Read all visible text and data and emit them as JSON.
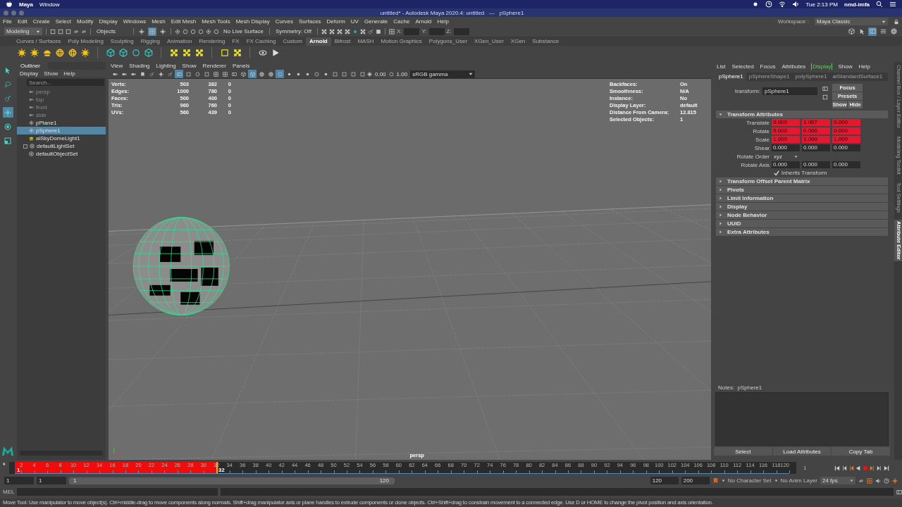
{
  "menubar": {
    "app": "Maya",
    "menus": [
      "Window"
    ],
    "clock": "Tue 2:13 PM",
    "user": "nmd-imfa"
  },
  "window": {
    "title": "untitled* - Autodesk Maya 2020.4: untitled   ---   pSphere1"
  },
  "main_menu": [
    "File",
    "Edit",
    "Create",
    "Select",
    "Modify",
    "Display",
    "Windows",
    "Mesh",
    "Edit Mesh",
    "Mesh Tools",
    "Mesh Display",
    "Curves",
    "Surfaces",
    "Deform",
    "UV",
    "Generate",
    "Cache",
    "Arnold",
    "Help"
  ],
  "workspace": {
    "label": "Workspace :",
    "value": "Maya Classic"
  },
  "status_line": {
    "menu_set": "Modeling",
    "selection_mode": "Objects",
    "live_surface": "No Live Surface",
    "symmetry": "Symmetry: Off",
    "coords": [
      "X:",
      "Y:",
      "Z:"
    ]
  },
  "shelf_tabs": [
    {
      "label": "Curves / Surfaces",
      "selected": false
    },
    {
      "label": "Poly Modeling",
      "selected": false
    },
    {
      "label": "Sculpting",
      "selected": false
    },
    {
      "label": "Rigging",
      "selected": false
    },
    {
      "label": "Animation",
      "selected": false
    },
    {
      "label": "Rendering",
      "selected": false
    },
    {
      "label": "FX",
      "selected": false
    },
    {
      "label": "FX Caching",
      "selected": false
    },
    {
      "label": "Custom",
      "selected": false
    },
    {
      "label": "Arnold",
      "selected": true
    },
    {
      "label": "Bifrost",
      "selected": false
    },
    {
      "label": "MASH",
      "selected": false
    },
    {
      "label": "Motion Graphics",
      "selected": false
    },
    {
      "label": "Polygons_User",
      "selected": false
    },
    {
      "label": "XGen_User",
      "selected": false
    },
    {
      "label": "XGen",
      "selected": false
    },
    {
      "label": "Substance",
      "selected": false
    }
  ],
  "toolbox": [
    {
      "kind": "pointer",
      "selected": false
    },
    {
      "kind": "lasso",
      "selected": false
    },
    {
      "kind": "brush",
      "selected": false
    },
    {
      "kind": "move",
      "selected": true
    },
    {
      "kind": "rotate",
      "selected": false
    },
    {
      "kind": "scale",
      "selected": false
    }
  ],
  "outliner": {
    "title": "Outliner",
    "menus": [
      "Display",
      "Show",
      "Help"
    ],
    "search_placeholder": "Search...",
    "items": [
      {
        "label": "persp",
        "kind": "camera",
        "dimmed": true,
        "selected": false
      },
      {
        "label": "top",
        "kind": "camera",
        "dimmed": true,
        "selected": false
      },
      {
        "label": "front",
        "kind": "camera",
        "dimmed": true,
        "selected": false
      },
      {
        "label": "side",
        "kind": "camera",
        "dimmed": true,
        "selected": false
      },
      {
        "label": "pPlane1",
        "kind": "transform",
        "dimmed": false,
        "selected": false
      },
      {
        "label": "pSphere1",
        "kind": "transform",
        "dimmed": false,
        "selected": true
      },
      {
        "label": "aiSkyDomeLight1",
        "kind": "light",
        "dimmed": false,
        "selected": false
      },
      {
        "label": "defaultLightSet",
        "kind": "set",
        "dimmed": false,
        "selected": false,
        "expandable": true
      },
      {
        "label": "defaultObjectSet",
        "kind": "set",
        "dimmed": false,
        "selected": false
      }
    ]
  },
  "viewport": {
    "menus": [
      "View",
      "Shading",
      "Lighting",
      "Show",
      "Renderer",
      "Panels"
    ],
    "exposure": "0.00",
    "gamma": "1.00",
    "color_space": "sRGB gamma",
    "stats": [
      {
        "label": "Verts:",
        "values": [
          "503",
          "382",
          "0"
        ]
      },
      {
        "label": "Edges:",
        "values": [
          "1000",
          "780",
          "0"
        ]
      },
      {
        "label": "Faces:",
        "values": [
          "500",
          "400",
          "0"
        ]
      },
      {
        "label": "Tris:",
        "values": [
          "960",
          "760",
          "0"
        ]
      },
      {
        "label": "UVs:",
        "values": [
          "560",
          "439",
          "0"
        ]
      }
    ],
    "info": [
      {
        "label": "Backfaces:",
        "value": "On"
      },
      {
        "label": "Smoothness:",
        "value": "N/A"
      },
      {
        "label": "Instance:",
        "value": "No"
      },
      {
        "label": "Display Layer:",
        "value": "default"
      },
      {
        "label": "Distance From Camera:",
        "value": "12.815"
      },
      {
        "label": "Selected Objects:",
        "value": "1"
      }
    ],
    "camera": "persp"
  },
  "attribute_editor": {
    "menus": [
      {
        "label": "List",
        "selected": false
      },
      {
        "label": "Selected",
        "selected": false
      },
      {
        "label": "Focus",
        "selected": false
      },
      {
        "label": "Attributes",
        "selected": false
      },
      {
        "label": "Display",
        "selected": true
      },
      {
        "label": "Show",
        "selected": false
      },
      {
        "label": "Help",
        "selected": false
      }
    ],
    "tabs": [
      {
        "label": "pSphere1",
        "selected": true
      },
      {
        "label": "pSphereShape1",
        "selected": false
      },
      {
        "label": "polySphere1",
        "selected": false
      },
      {
        "label": "aiStandardSurface1",
        "selected": false
      }
    ],
    "node_label": "transform:",
    "node_name": "pSphere1",
    "buttons": [
      "Focus",
      "Presets",
      "Show",
      "Hide"
    ],
    "sections": [
      {
        "title": "Transform Attributes",
        "expanded": true,
        "rows": [
          {
            "label": "Translate",
            "kind": "vector",
            "keyed": true,
            "values": [
              "0.000",
              "1.007",
              "0.000"
            ]
          },
          {
            "label": "Rotate",
            "kind": "vector",
            "keyed": true,
            "values": [
              "0.000",
              "0.000",
              "0.000"
            ]
          },
          {
            "label": "Scale",
            "kind": "vector",
            "keyed": true,
            "values": [
              "1.000",
              "1.000",
              "1.000"
            ]
          },
          {
            "label": "Shear",
            "kind": "vector",
            "keyed": false,
            "values": [
              "0.000",
              "0.000",
              "0.000"
            ]
          },
          {
            "label": "Rotate Order",
            "kind": "dropdown",
            "value": "xyz"
          },
          {
            "label": "Rotate Axis",
            "kind": "vector",
            "keyed": false,
            "values": [
              "0.000",
              "0.000",
              "0.000"
            ]
          },
          {
            "label": "Inherits Transform",
            "kind": "checkbox",
            "checked": true
          }
        ]
      },
      {
        "title": "Transform Offset Parent Matrix",
        "expanded": false
      },
      {
        "title": "Pivots",
        "expanded": false
      },
      {
        "title": "Limit Information",
        "expanded": false
      },
      {
        "title": "Display",
        "expanded": false
      },
      {
        "title": "Node Behavior",
        "expanded": false
      },
      {
        "title": "UUID",
        "expanded": false
      },
      {
        "title": "Extra Attributes",
        "expanded": false
      }
    ],
    "notes_label": "Notes:",
    "notes_node": "pSphere1",
    "footer_buttons": [
      "Select",
      "Load Attributes",
      "Copy Tab"
    ]
  },
  "side_tabs": [
    {
      "label": "Channel Box / Layer Editor",
      "selected": false
    },
    {
      "label": "Modeling Toolkit",
      "selected": false
    },
    {
      "label": "Tool Settings",
      "selected": false
    },
    {
      "label": "Attribute Editor",
      "selected": true
    }
  ],
  "timeline": {
    "start_label": "1",
    "ticks": [
      "2",
      "4",
      "6",
      "8",
      "10",
      "12",
      "14",
      "16",
      "18",
      "20",
      "22",
      "24",
      "26",
      "28",
      "30",
      "32",
      "34",
      "36",
      "38",
      "40",
      "42",
      "44",
      "46",
      "48",
      "50",
      "52",
      "54",
      "56",
      "58",
      "60",
      "62",
      "64",
      "66",
      "68",
      "70",
      "72",
      "74",
      "76",
      "78",
      "80",
      "82",
      "84",
      "86",
      "88",
      "90",
      "92",
      "94",
      "96",
      "98",
      "100",
      "102",
      "104",
      "106",
      "108",
      "110",
      "112",
      "114",
      "116",
      "118",
      "120"
    ],
    "current_frame": "32",
    "frame_field": "1",
    "keys": {
      "level": 0.26
    }
  },
  "range": {
    "start": "1",
    "playback_start": "1",
    "slider": {
      "level": 1
    },
    "slider_start": "1",
    "slider_end": "120",
    "playback_end": "120",
    "end": "200",
    "character_set": "No Character Set",
    "anim_layer": "No Anim Layer",
    "fps": "24 fps"
  },
  "command_line": {
    "language": "MEL"
  },
  "help_line": "Move Tool: Use manipulator to move object(s). Ctrl+middle-drag to move components along normals. Shift+drag manipulator axis or plane handles to extrude components or clone objects. Ctrl+Shift+drag to constrain movement to a connected edge. Use D or HOME to change the pivot position and axis orientation."
}
